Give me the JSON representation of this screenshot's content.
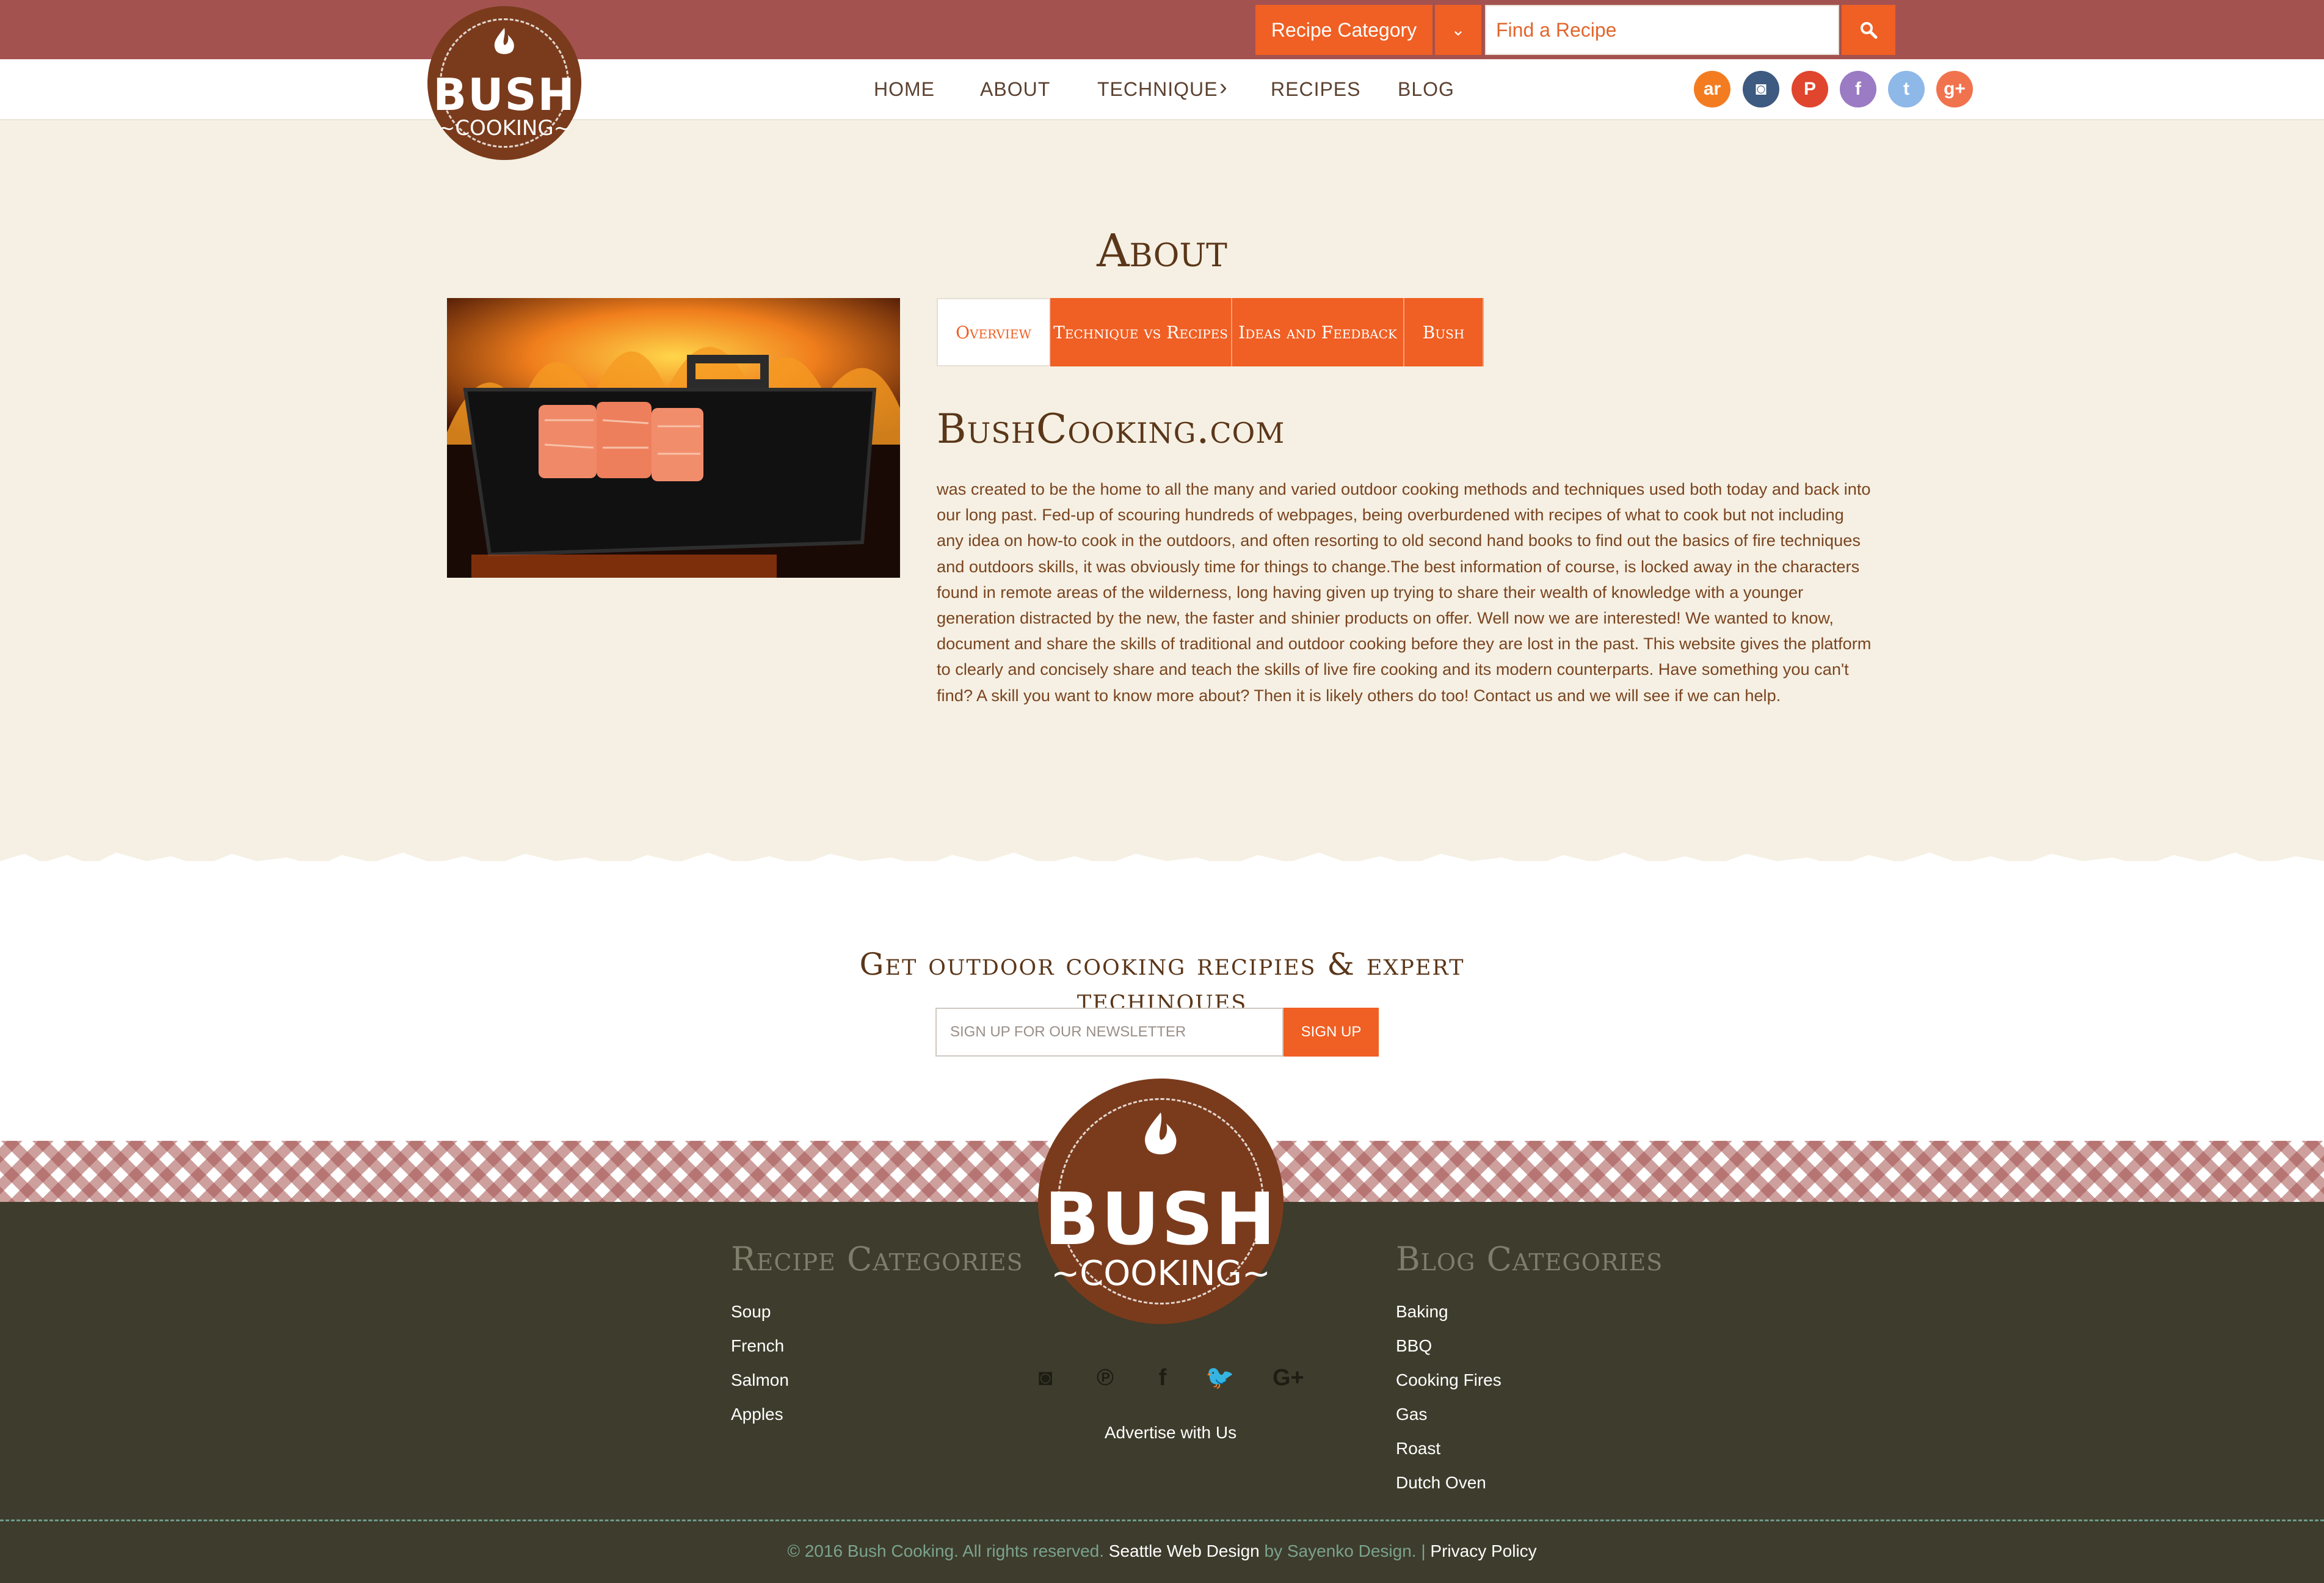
{
  "header": {
    "category_label": "Recipe Category",
    "search_placeholder": "Find a Recipe"
  },
  "nav": {
    "items": [
      "HOME",
      "ABOUT",
      "TECHNIQUE",
      "RECIPES",
      "BLOG"
    ],
    "technique_chevron": "›"
  },
  "social_top": [
    {
      "icon": "allrecipes-icon",
      "glyph": "ar",
      "color": "#f47c20"
    },
    {
      "icon": "instagram-icon",
      "glyph": "◙",
      "color": "#3d5a80"
    },
    {
      "icon": "pinterest-icon",
      "glyph": "P",
      "color": "#e0452e"
    },
    {
      "icon": "facebook-icon",
      "glyph": "f",
      "color": "#9a7bc4"
    },
    {
      "icon": "twitter-icon",
      "glyph": "t",
      "color": "#8eb8e8"
    },
    {
      "icon": "google-plus-icon",
      "glyph": "g+",
      "color": "#f0734e"
    }
  ],
  "logo": {
    "line1": "BUSH",
    "line2": "~COOKING~"
  },
  "main": {
    "title": "About",
    "tabs": [
      "Overview",
      "Technique vs Recipes",
      "Ideas and Feedback",
      "Bush"
    ],
    "heading": "BushCooking.com",
    "body": "was created to be the home to all the many and varied outdoor cooking methods and techniques used both today and back into our long past. Fed-up of scouring hundreds of webpages, being overburdened with recipes of what to cook but not including any idea on how-to cook in the outdoors, and often resorting to old second hand books to find out the basics of fire techniques and outdoors skills, it was obviously time for things to change.The best information of course, is locked away in the characters found in remote areas of the wilderness, long having given up trying to share their wealth of knowledge with a younger generation distracted by the new, the faster and shinier products on offer. Well now we are interested! We wanted to know, document and share the skills of traditional and outdoor cooking before they are lost in the past. This website gives the platform to clearly and concisely share and teach the skills of live fire cooking and its modern counterparts. Have something you can't find? A skill you want to know more about? Then it is likely others do too! Contact us and we will see if we can help."
  },
  "newsletter": {
    "title": "Get outdoor cooking recipies & expert techinques",
    "placeholder": "SIGN UP FOR OUR NEWSLETTER",
    "button": "SIGN UP"
  },
  "footer": {
    "recipe_heading": "Recipe Categories",
    "recipe_links": [
      "Soup",
      "French",
      "Salmon",
      "Apples"
    ],
    "blog_heading": "Blog Categories",
    "blog_links": [
      "Baking",
      "BBQ",
      "Cooking Fires",
      "Gas",
      "Roast",
      "Dutch Oven"
    ],
    "social": [
      {
        "icon": "instagram-icon",
        "glyph": "◙"
      },
      {
        "icon": "pinterest-icon",
        "glyph": "℗"
      },
      {
        "icon": "facebook-icon",
        "glyph": "f"
      },
      {
        "icon": "twitter-icon",
        "glyph": "🐦"
      },
      {
        "icon": "google-plus-icon",
        "glyph": "G+"
      }
    ],
    "advertise": "Advertise with Us",
    "copyright": "© 2016 Bush Cooking. All rights reserved.",
    "seattle": "Seattle Web Design",
    "by": "by Sayenko Design.",
    "sep": "|",
    "privacy": "Privacy Policy"
  },
  "colors": {
    "topbar": "#a4524f",
    "accent": "#f05f23",
    "brown": "#7a3b1c",
    "footer": "#3e3c2c"
  }
}
